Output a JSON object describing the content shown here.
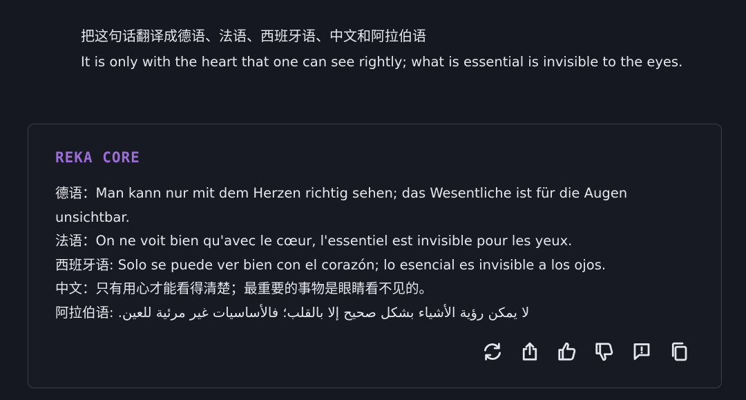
{
  "user_message": {
    "line1": "把这句话翻译成德语、法语、西班牙语、中文和阿拉伯语",
    "line2": "It is only with the heart that one can see rightly; what is essential is invisible to the eyes."
  },
  "reply": {
    "model_name": "REKA CORE",
    "rows": [
      {
        "label": "德语：",
        "text": "Man kann nur mit dem Herzen richtig sehen; das Wesentliche ist für die Augen unsichtbar."
      },
      {
        "label": "法语：",
        "text": "On ne voit bien qu'avec le cœur, l'essentiel est invisible pour les yeux."
      },
      {
        "label": "西班牙语: ",
        "text": "Solo se puede ver bien con el corazón; lo esencial es invisible a los ojos."
      },
      {
        "label": "中文：",
        "text": "只有用心才能看得清楚；最重要的事物是眼睛看不见的。"
      },
      {
        "label": "阿拉伯语: ",
        "text": "لا يمكن رؤية الأشياء بشكل صحيح إلا بالقلب؛ فالأساسيات غير مرئية للعين."
      }
    ]
  },
  "actions": [
    {
      "icon": "regenerate-icon"
    },
    {
      "icon": "share-icon"
    },
    {
      "icon": "thumbs-up-icon"
    },
    {
      "icon": "thumbs-down-icon"
    },
    {
      "icon": "report-icon"
    },
    {
      "icon": "copy-icon"
    }
  ],
  "colors": {
    "background": "#161821",
    "card_border": "#3a3d4a",
    "text": "#e6e7ee",
    "accent": "#9b6ed6"
  }
}
